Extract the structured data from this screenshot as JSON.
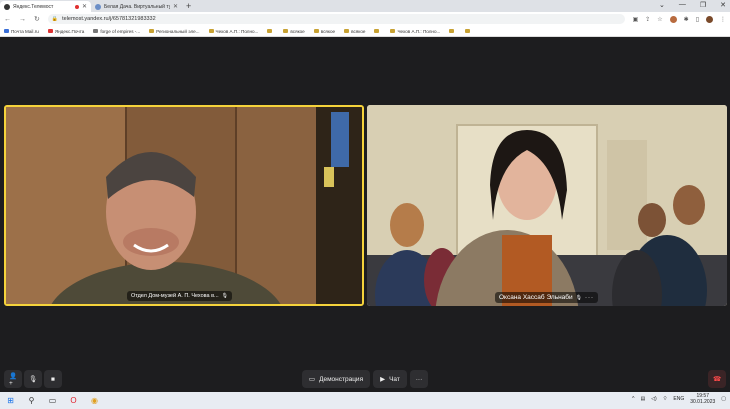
{
  "browser": {
    "tabs": [
      {
        "title": "Яндекс.Телемост",
        "active": true,
        "recording": true
      },
      {
        "title": "Белая Дача. Виртуальный тур",
        "active": false
      }
    ],
    "new_tab": "+",
    "url": "telemost.yandex.ru/j/65781321983332",
    "bookmarks": [
      {
        "label": "Почта Mail.ru",
        "icon": "blue"
      },
      {
        "label": "Яндекс.Почта",
        "icon": "red"
      },
      {
        "label": "forge of empires -...",
        "icon": "gray"
      },
      {
        "label": "Региональный эле...",
        "icon": "gray"
      },
      {
        "label": "Чехов А.П.: Полно...",
        "icon": "folder"
      },
      {
        "label": "",
        "icon": "folder"
      },
      {
        "label": "всякое",
        "icon": "folder"
      },
      {
        "label": "всякое",
        "icon": "folder"
      },
      {
        "label": "всякое",
        "icon": "folder"
      },
      {
        "label": "",
        "icon": "folder"
      },
      {
        "label": "Чехов А.П.: Полно...",
        "icon": "folder"
      },
      {
        "label": "",
        "icon": "folder"
      },
      {
        "label": "",
        "icon": "folder"
      }
    ]
  },
  "call": {
    "participants": [
      {
        "name": "Отдел Дом-музей А. П. Чехова в..."
      },
      {
        "name": "Оксана Хассаб Эльнаби"
      }
    ],
    "controls": {
      "screen_share": "Демонстрация",
      "chat": "Чат",
      "more": "···"
    }
  },
  "taskbar": {
    "language": "ENG",
    "time": "19:57",
    "date": "30.01.2023"
  },
  "colors": {
    "active_speaker_border": "#f5d33b",
    "hangup": "#ff4a4a"
  }
}
